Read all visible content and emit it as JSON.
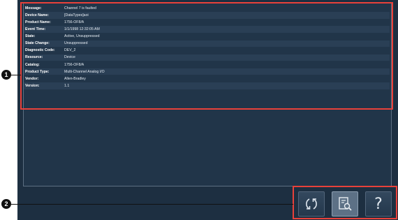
{
  "details": {
    "rows": [
      {
        "label": "Message:",
        "value": "Channel 7 is faulted"
      },
      {
        "label": "Device Name:",
        "value": "[DataTypes]aoi"
      },
      {
        "label": "Product Name:",
        "value": "1756-OF8/A"
      },
      {
        "label": "Event Time:",
        "value": "1/1/1998 12:32:05 AM"
      },
      {
        "label": "State:",
        "value": "Active, Unsuppressed"
      },
      {
        "label": "State Change:",
        "value": "Unsuppressed"
      },
      {
        "label": "Diagnostic Code:",
        "value": "DEV_2"
      },
      {
        "label": "Resource:",
        "value": "Device"
      },
      {
        "label": "Catalog:",
        "value": "1756-OF8/A"
      },
      {
        "label": "Product Type:",
        "value": "Multi-Channel Analog I/O"
      },
      {
        "label": "Vendor:",
        "value": "Allen-Bradley"
      },
      {
        "label": "Version:",
        "value": "1.1"
      }
    ]
  },
  "callouts": {
    "one": "1",
    "two": "2"
  },
  "buttons": {
    "refresh_icon": "refresh-icon",
    "details_icon": "details-search-icon",
    "help_label": "?"
  },
  "colors": {
    "background": "#1d2f41",
    "highlight": "#e8413a"
  }
}
